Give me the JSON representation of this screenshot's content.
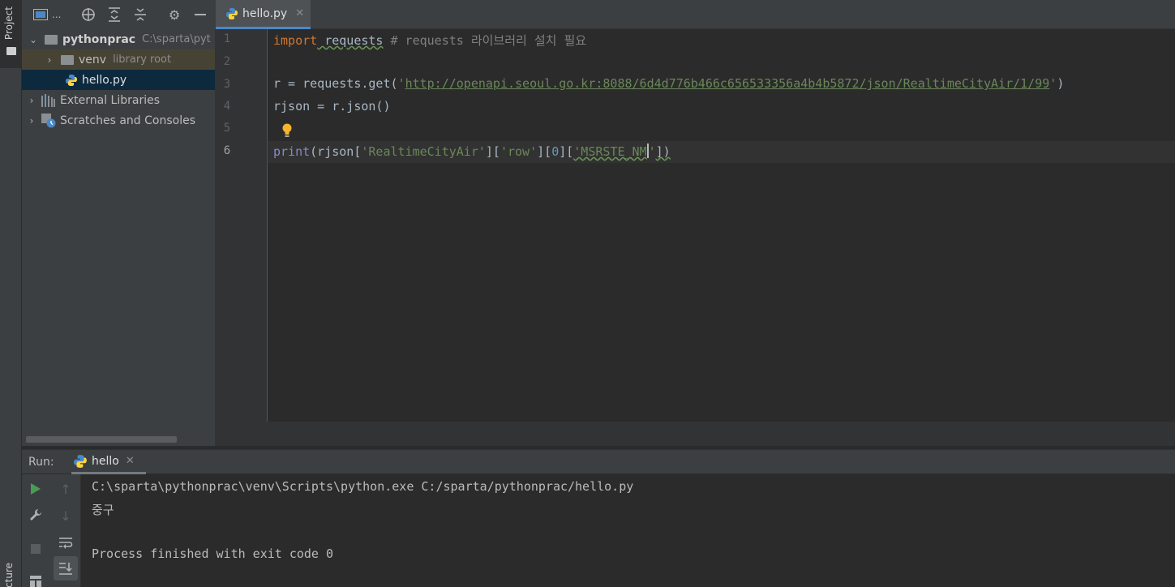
{
  "tool_stripe": {
    "project_label": "Project",
    "structure_label": "Structure"
  },
  "project_toolbar": {
    "icons": [
      "project-view-icon",
      "locate-icon",
      "expand-all-icon",
      "collapse-all-icon",
      "gear-icon",
      "minimize-icon"
    ],
    "dropdown_ellipsis": "..."
  },
  "tree": {
    "root": {
      "name": "pythonprac",
      "path": "C:\\sparta\\pyt"
    },
    "venv": {
      "name": "venv",
      "hint": "library root"
    },
    "file": {
      "name": "hello.py"
    },
    "external_libraries": "External Libraries",
    "scratches": "Scratches and Consoles"
  },
  "editor": {
    "tab_label": "hello.py",
    "line_numbers": [
      "1",
      "2",
      "3",
      "4",
      "5",
      "6"
    ],
    "current_line": 6,
    "lines": {
      "l1_kw": "import",
      "l1_mod": " requests",
      "l1_comment": "# requests 라이브러리 설치 필요",
      "l3_pre": "r = requests.get(",
      "l3_q1": "'",
      "l3_url": "http://openapi.seoul.go.kr:8088/6d4d776b466c656533356a4b4b5872/json/RealtimeCityAir/1/99",
      "l3_q2": "'",
      "l3_post": ")",
      "l4": "rjson = r.json()",
      "l6_fn": "print",
      "l6_a": "(rjson[",
      "l6_s1": "'RealtimeCityAir'",
      "l6_b": "][",
      "l6_s2": "'row'",
      "l6_c": "][",
      "l6_n": "0",
      "l6_d": "][",
      "l6_s3a": "'MSRSTE_NM",
      "l6_s3b": "'",
      "l6_e": "])"
    }
  },
  "run": {
    "label": "Run:",
    "tab_label": "hello",
    "icons": [
      "run-icon",
      "wrench-icon",
      "stop-icon",
      "layout-icon",
      "up-arrow-icon",
      "down-arrow-icon",
      "soft-wrap-icon",
      "scroll-to-end-icon"
    ],
    "console": {
      "command": "C:\\sparta\\pythonprac\\venv\\Scripts\\python.exe C:/sparta/pythonprac/hello.py",
      "output": "중구",
      "exit": "Process finished with exit code 0"
    }
  },
  "colors": {
    "keyword": "#cc7832",
    "string": "#6a8759",
    "number": "#6897bb",
    "comment": "#808080",
    "selection": "#0d293e",
    "tab_underline": "#4a88c7"
  }
}
